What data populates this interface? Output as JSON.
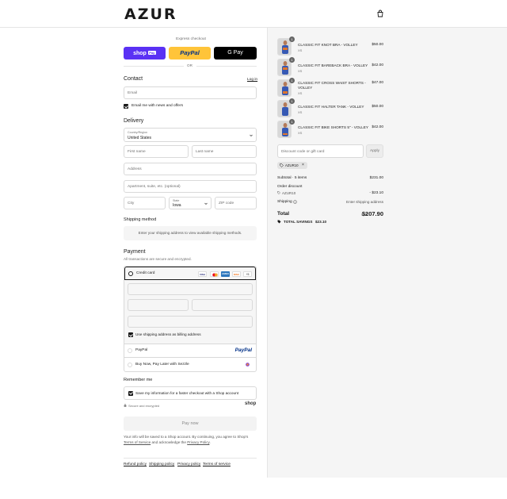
{
  "brand": {
    "name": "AZUR"
  },
  "header": {
    "cart_icon": "bag-icon"
  },
  "express": {
    "label": "Express checkout",
    "shop_pay": "shop",
    "shop_pay_badge": "Pay",
    "paypal": "PayPal",
    "gpay": "G Pay",
    "or": "OR"
  },
  "contact": {
    "title": "Contact",
    "login": "Log in",
    "email_placeholder": "Email",
    "news_label": "Email me with news and offers"
  },
  "delivery": {
    "title": "Delivery",
    "country_label": "Country/Region",
    "country_value": "United States",
    "first_name": "First name",
    "last_name": "Last name",
    "address": "Address",
    "apartment": "Apartment, suite, etc. (optional)",
    "city": "City",
    "state_label": "State",
    "state_value": "Iowa",
    "zip": "ZIP code"
  },
  "shipping_method": {
    "title": "Shipping method",
    "note": "Enter your shipping address to view available shipping methods."
  },
  "payment": {
    "title": "Payment",
    "subtitle": "All transactions are secure and encrypted.",
    "credit_card": "Credit card",
    "card_more": "+5",
    "cards": [
      "VISA",
      "MC",
      "AMEX",
      "DISC"
    ],
    "billing_label": "Use shipping address as billing address",
    "paypal": "PayPal",
    "paypal_logo": "PayPal",
    "sezzle": "Buy Now, Pay Later with Sezzle"
  },
  "remember": {
    "title": "Remember me",
    "label": "Save my information for a faster checkout with a Shop account",
    "secure": "Secure and encrypted",
    "shop": "shop"
  },
  "pay_now": "Pay now",
  "legal": {
    "line1": "Your info will be saved to a Shop account. By continuing, you agree to Shop's",
    "terms": "Terms of Service",
    "and": "and acknowledge the",
    "privacy": "Privacy Policy",
    "end": "."
  },
  "footer_links": [
    "Refund policy",
    "Shipping policy",
    "Privacy policy",
    "Terms of service"
  ],
  "cart": {
    "items": [
      {
        "name": "CLASSIC FIT KNOT BRA - VOLLEY",
        "variant": "XS",
        "price": "$50.00",
        "qty": "1"
      },
      {
        "name": "CLASSIC FIT BAREBACK BRA - VOLLEY",
        "variant": "XS",
        "price": "$42.00",
        "qty": "1"
      },
      {
        "name": "CLASSIC FIT CROSS WAIST SHORTS - VOLLEY",
        "variant": "XS",
        "price": "$47.00",
        "qty": "1"
      },
      {
        "name": "CLASSIC FIT HALTER TANK - VOLLEY",
        "variant": "XS",
        "price": "$50.00",
        "qty": "1"
      },
      {
        "name": "CLASSIC FIT BIKE SHORTS 5\" - VOLLEY",
        "variant": "XS",
        "price": "$42.00",
        "qty": "1"
      }
    ],
    "discount_placeholder": "Discount code or gift card",
    "apply": "Apply",
    "applied_code": "AZUR10",
    "subtotal_label": "Subtotal · 5 items",
    "subtotal_value": "$231.00",
    "order_discount_label": "Order discount",
    "discount_code": "AZUR10",
    "discount_value": "- $23.10",
    "shipping_label": "Shipping",
    "shipping_value": "Enter shipping address",
    "total_label": "Total",
    "currency": "USD",
    "total_value": "$207.90",
    "savings_label": "TOTAL SAVINGS",
    "savings_value": "$23.10"
  },
  "colors": {
    "shop_pay": "#5a31f4",
    "paypal_btn": "#ffc439",
    "gpay": "#000000"
  }
}
